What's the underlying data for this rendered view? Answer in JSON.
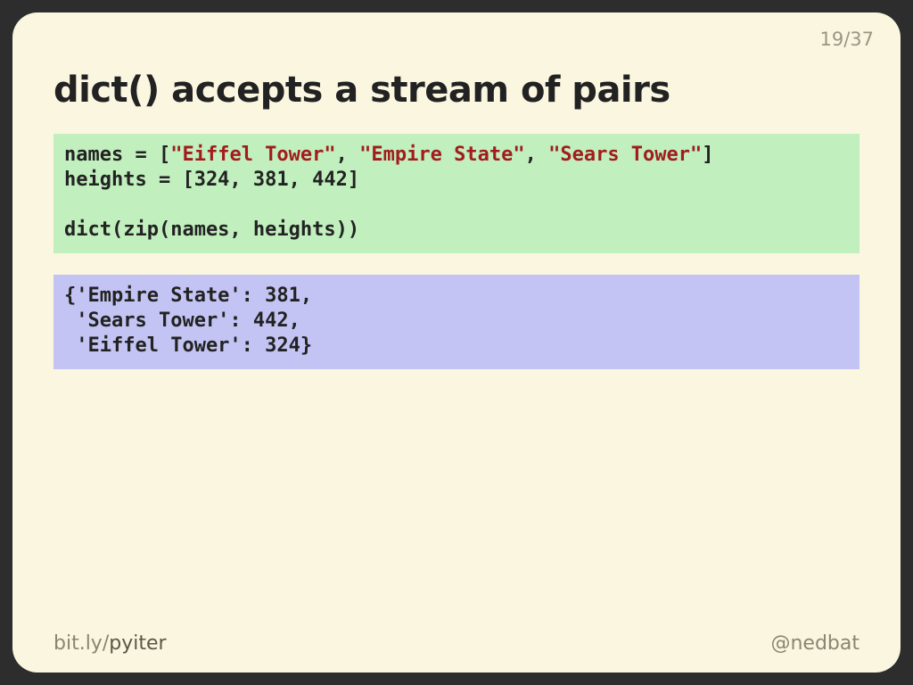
{
  "slide": {
    "number": {
      "current": "19",
      "sep": "/",
      "total": "37"
    },
    "title": "dict() accepts a stream of pairs",
    "code": {
      "line1_a": "names = [",
      "str1": "\"Eiffel Tower\"",
      "line1_b": ", ",
      "str2": "\"Empire State\"",
      "line1_c": ", ",
      "str3": "\"Sears Tower\"",
      "line1_d": "]",
      "line2": "heights = [324, 381, 442]",
      "line3": "",
      "line4": "dict(zip(names, heights))"
    },
    "output": {
      "line1": "{'Empire State': 381,",
      "line2": " 'Sears Tower': 442,",
      "line3": " 'Eiffel Tower': 324}"
    },
    "footer": {
      "link_prefix": "bit.ly/",
      "link_suffix": "pyiter",
      "handle": "@nedbat"
    }
  }
}
